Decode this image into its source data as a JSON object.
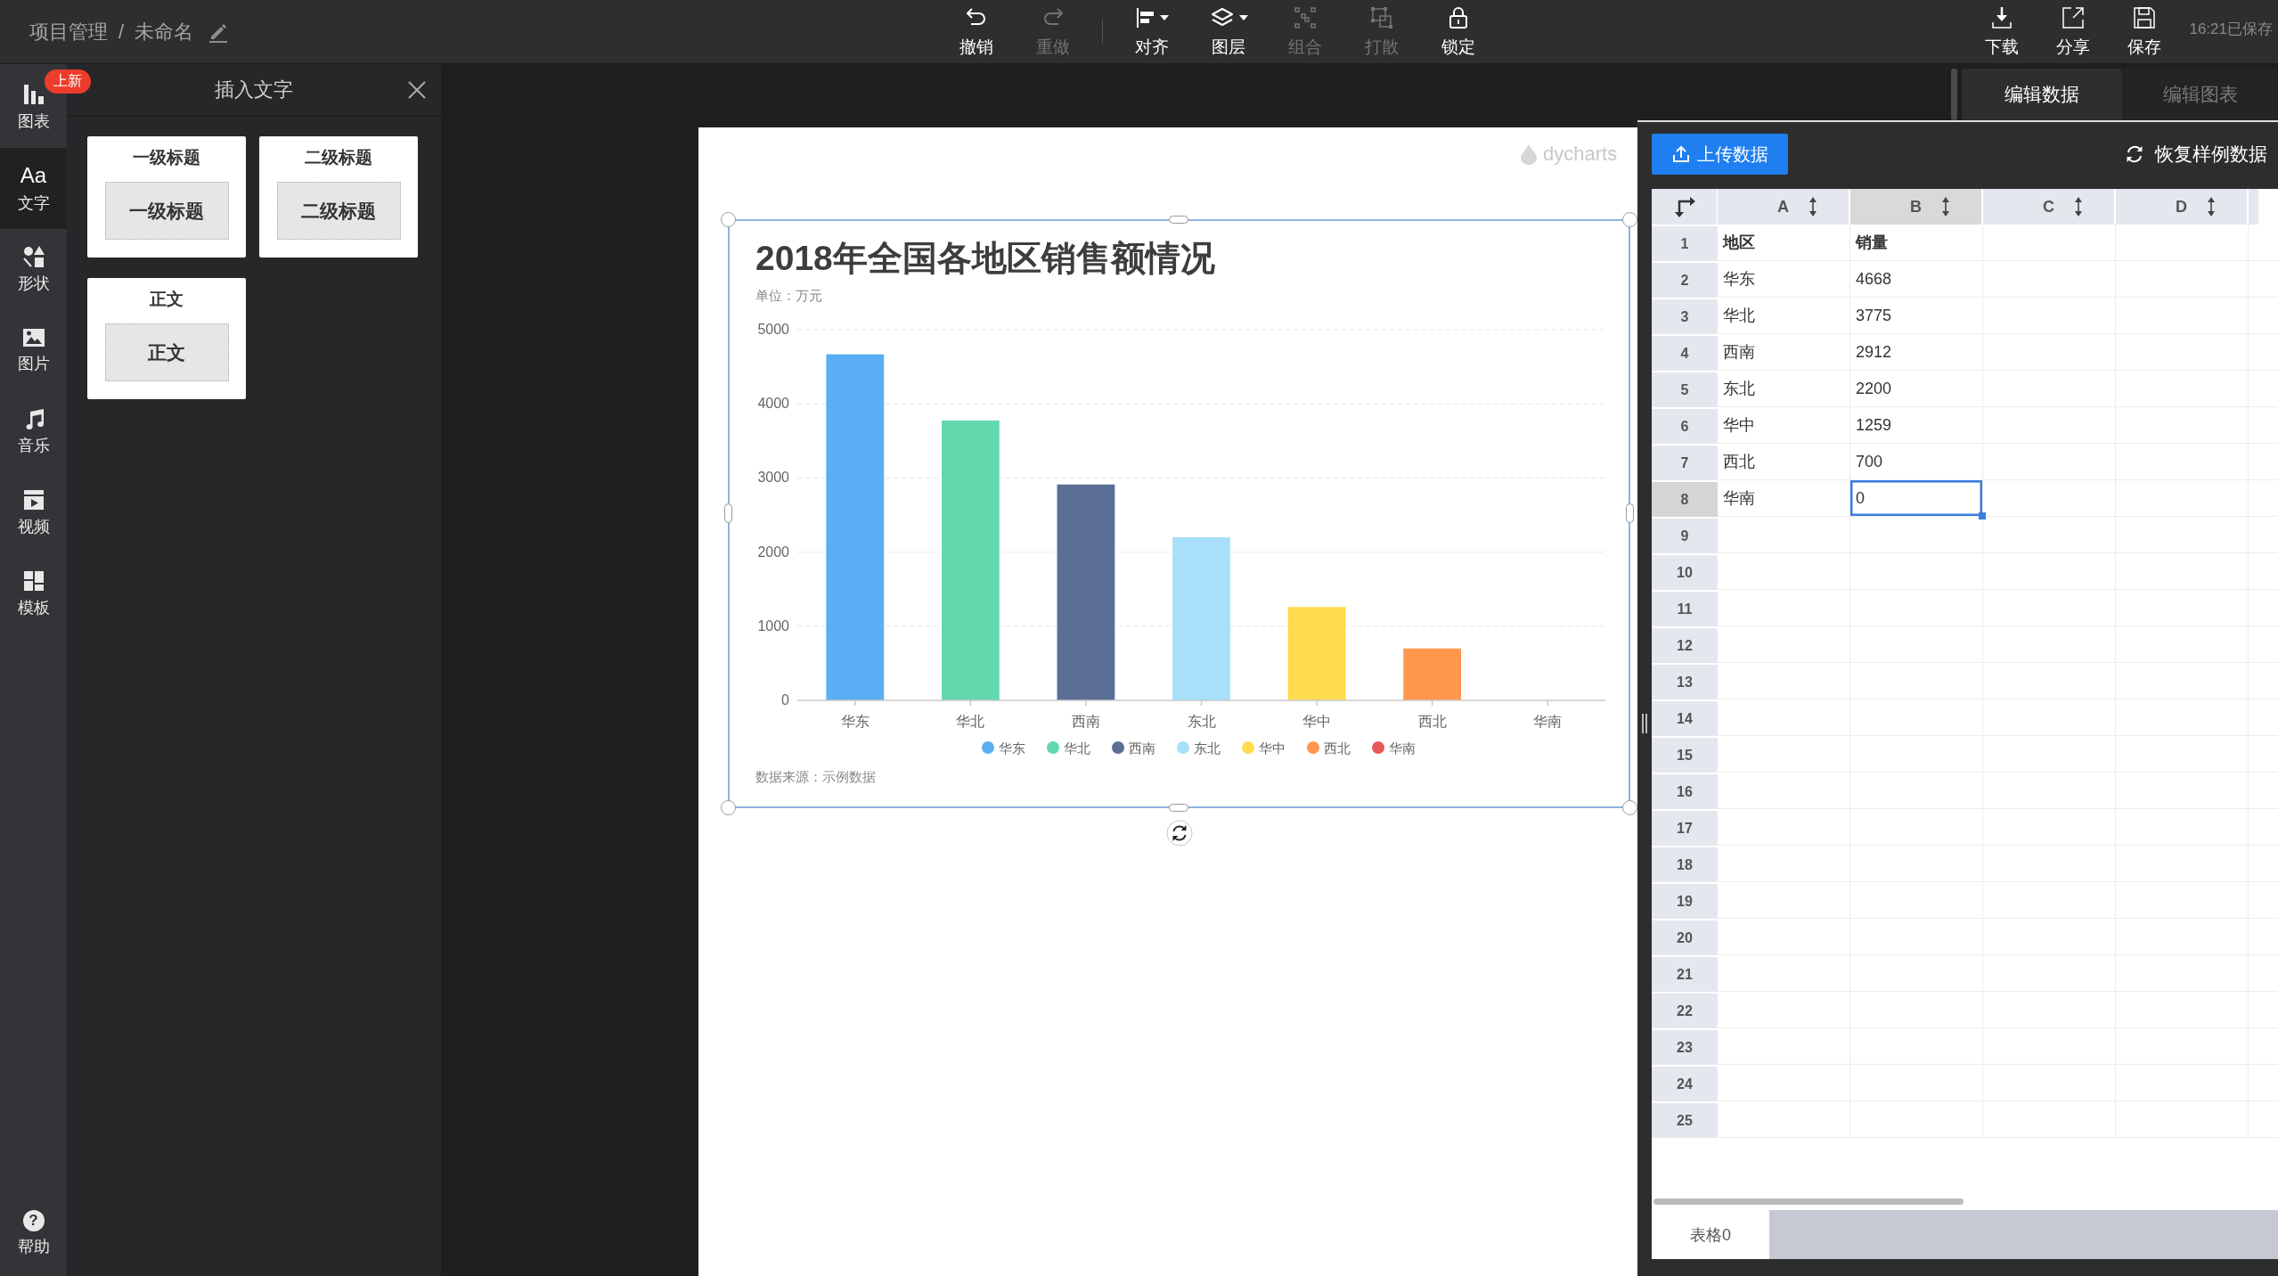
{
  "topbar": {
    "breadcrumb": [
      "项目管理",
      "未命名"
    ],
    "separator": "/",
    "toolbar": [
      [
        {
          "label": "撤销",
          "disabled": false,
          "dropdown": false
        },
        {
          "label": "重做",
          "disabled": true,
          "dropdown": false
        }
      ],
      [
        {
          "label": "对齐",
          "disabled": false,
          "dropdown": true
        },
        {
          "label": "图层",
          "disabled": false,
          "dropdown": true
        },
        {
          "label": "组合",
          "disabled": true,
          "dropdown": false
        },
        {
          "label": "打散",
          "disabled": true,
          "dropdown": false
        },
        {
          "label": "锁定",
          "disabled": false,
          "dropdown": false
        }
      ]
    ],
    "actions": [
      "下载",
      "分享",
      "保存"
    ],
    "save_status": "16:21已保存"
  },
  "sidebar": {
    "items": [
      {
        "label": "图表",
        "selected": false,
        "badge": "上新"
      },
      {
        "label": "文字",
        "selected": true,
        "glyph": "Aa"
      },
      {
        "label": "形状",
        "selected": false
      },
      {
        "label": "图片",
        "selected": false
      },
      {
        "label": "音乐",
        "selected": false
      },
      {
        "label": "视频",
        "selected": false
      },
      {
        "label": "模板",
        "selected": false
      }
    ],
    "help": {
      "label": "帮助",
      "glyph": "?"
    }
  },
  "insert_panel": {
    "title": "插入文字",
    "cards": [
      {
        "title": "一级标题",
        "preview": "一级标题"
      },
      {
        "title": "二级标题",
        "preview": "二级标题"
      },
      {
        "title": "正文",
        "preview": "正文"
      }
    ]
  },
  "canvas": {
    "logo_text": "dycharts",
    "chart": {
      "selected": true,
      "chart_data": [
        {
          "type": "bar",
          "title": "2018年全国各地区销售额情况",
          "subtitle": "单位：万元",
          "categories": [
            "华东",
            "华北",
            "西南",
            "东北",
            "华中",
            "西北",
            "华南"
          ],
          "stacked": true,
          "series": [
            {
              "name": "华东",
              "color": "#5aaef3",
              "values": [
                4668,
                null,
                null,
                null,
                null,
                null,
                null
              ]
            },
            {
              "name": "华北",
              "color": "#62d9ad",
              "values": [
                null,
                3775,
                null,
                null,
                null,
                null,
                null
              ]
            },
            {
              "name": "西南",
              "color": "#5b6e96",
              "values": [
                null,
                null,
                2912,
                null,
                null,
                null,
                null
              ]
            },
            {
              "name": "东北",
              "color": "#a8dffa",
              "values": [
                null,
                null,
                null,
                2200,
                null,
                null,
                null
              ]
            },
            {
              "name": "华中",
              "color": "#ffdc4c",
              "values": [
                null,
                null,
                null,
                null,
                1259,
                null,
                null
              ]
            },
            {
              "name": "西北",
              "color": "#ff974c",
              "values": [
                null,
                null,
                null,
                null,
                null,
                700,
                null
              ]
            },
            {
              "name": "华南",
              "color": "#e65a56",
              "values": [
                null,
                null,
                null,
                null,
                null,
                null,
                0
              ]
            }
          ],
          "yticks": [
            0,
            1000,
            2000,
            3000,
            4000,
            5000
          ],
          "ylim": [
            0,
            5000
          ],
          "grid": true,
          "legend": "bottom"
        }
      ],
      "source": "数据来源：示例数据"
    }
  },
  "data_panel": {
    "tabs": [
      {
        "label": "编辑数据",
        "selected": true
      },
      {
        "label": "编辑图表",
        "selected": false
      }
    ],
    "upload_button": "上传数据",
    "restore_button": "恢复样例数据",
    "sheet": {
      "columns": [
        {
          "label": "A",
          "selected": false
        },
        {
          "label": "B",
          "selected": true
        },
        {
          "label": "C",
          "selected": false
        },
        {
          "label": "D",
          "selected": false
        }
      ],
      "rows": [
        {
          "label": "1",
          "selected": false,
          "cells": [
            {
              "text": "地区",
              "selected": false
            },
            {
              "text": "销量",
              "selected": false
            }
          ]
        },
        {
          "label": "2",
          "selected": false,
          "cells": [
            {
              "text": "华东",
              "selected": false
            },
            {
              "text": "4668",
              "selected": false
            }
          ]
        },
        {
          "label": "3",
          "selected": false,
          "cells": [
            {
              "text": "华北",
              "selected": false
            },
            {
              "text": "3775",
              "selected": false
            }
          ]
        },
        {
          "label": "4",
          "selected": false,
          "cells": [
            {
              "text": "西南",
              "selected": false
            },
            {
              "text": "2912",
              "selected": false
            }
          ]
        },
        {
          "label": "5",
          "selected": false,
          "cells": [
            {
              "text": "东北",
              "selected": false
            },
            {
              "text": "2200",
              "selected": false
            }
          ]
        },
        {
          "label": "6",
          "selected": false,
          "cells": [
            {
              "text": "华中",
              "selected": false
            },
            {
              "text": "1259",
              "selected": false
            }
          ]
        },
        {
          "label": "7",
          "selected": false,
          "cells": [
            {
              "text": "西北",
              "selected": false
            },
            {
              "text": "700",
              "selected": false
            }
          ]
        },
        {
          "label": "8",
          "selected": true,
          "cells": [
            {
              "text": "华南",
              "selected": false
            },
            {
              "text": "0",
              "selected": true
            }
          ]
        },
        {
          "label": "9",
          "selected": false
        },
        {
          "label": "10",
          "selected": false
        },
        {
          "label": "11",
          "selected": false
        },
        {
          "label": "12",
          "selected": false
        },
        {
          "label": "13",
          "selected": false
        },
        {
          "label": "14",
          "selected": false
        },
        {
          "label": "15",
          "selected": false
        },
        {
          "label": "16",
          "selected": false
        },
        {
          "label": "17",
          "selected": false
        },
        {
          "label": "18",
          "selected": false
        },
        {
          "label": "19",
          "selected": false
        },
        {
          "label": "20",
          "selected": false
        },
        {
          "label": "21",
          "selected": false
        },
        {
          "label": "22",
          "selected": false
        },
        {
          "label": "23",
          "selected": false
        },
        {
          "label": "24",
          "selected": false
        },
        {
          "label": "25",
          "selected": false
        }
      ]
    },
    "sheet_tabs": [
      {
        "label": "表格0",
        "selected": true
      }
    ]
  }
}
